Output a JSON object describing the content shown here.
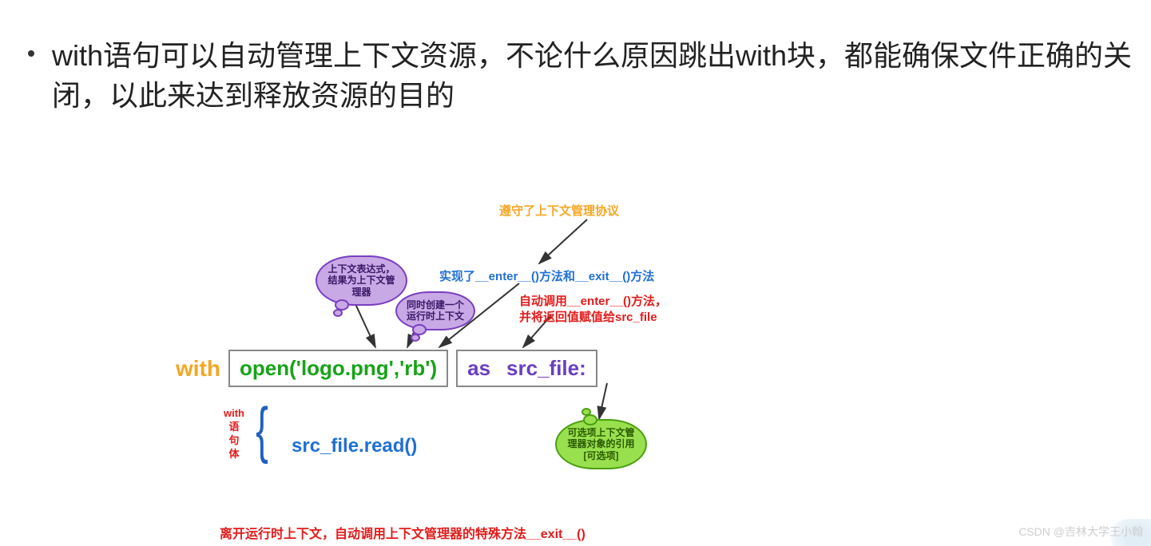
{
  "heading": "with语句可以自动管理上下文资源，不论什么原因跳出with块，都能确保文件正确的关闭，以此来达到释放资源的目的",
  "labels": {
    "protocol": "遵守了上下文管理协议",
    "enter_exit": "实现了__enter__()方法和__exit__()方法",
    "auto_call_line1": "自动调用__enter__()方法，",
    "auto_call_line2": "并将返回值赋值给src_file",
    "exit_call": "离开运行时上下文，自动调用上下文管理器的特殊方法__exit__()"
  },
  "clouds": {
    "expr_line1": "上下文表达式，",
    "expr_line2": "结果为上下文管",
    "expr_line3": "理器",
    "runtime_line1": "同时创建一个",
    "runtime_line2": "运行时上下文",
    "optional_line1": "可选项上下文管",
    "optional_line2": "理器对象的引用",
    "optional_line3": "[可选项]"
  },
  "code": {
    "with": "with",
    "open": "open('logo.png','rb')",
    "as": "as",
    "srcfile": "src_file:",
    "body": "src_file.read()"
  },
  "brace": {
    "l1": "with",
    "l2": "语",
    "l3": "句",
    "l4": "体"
  },
  "watermark": "CSDN @吉林大学王小翰"
}
